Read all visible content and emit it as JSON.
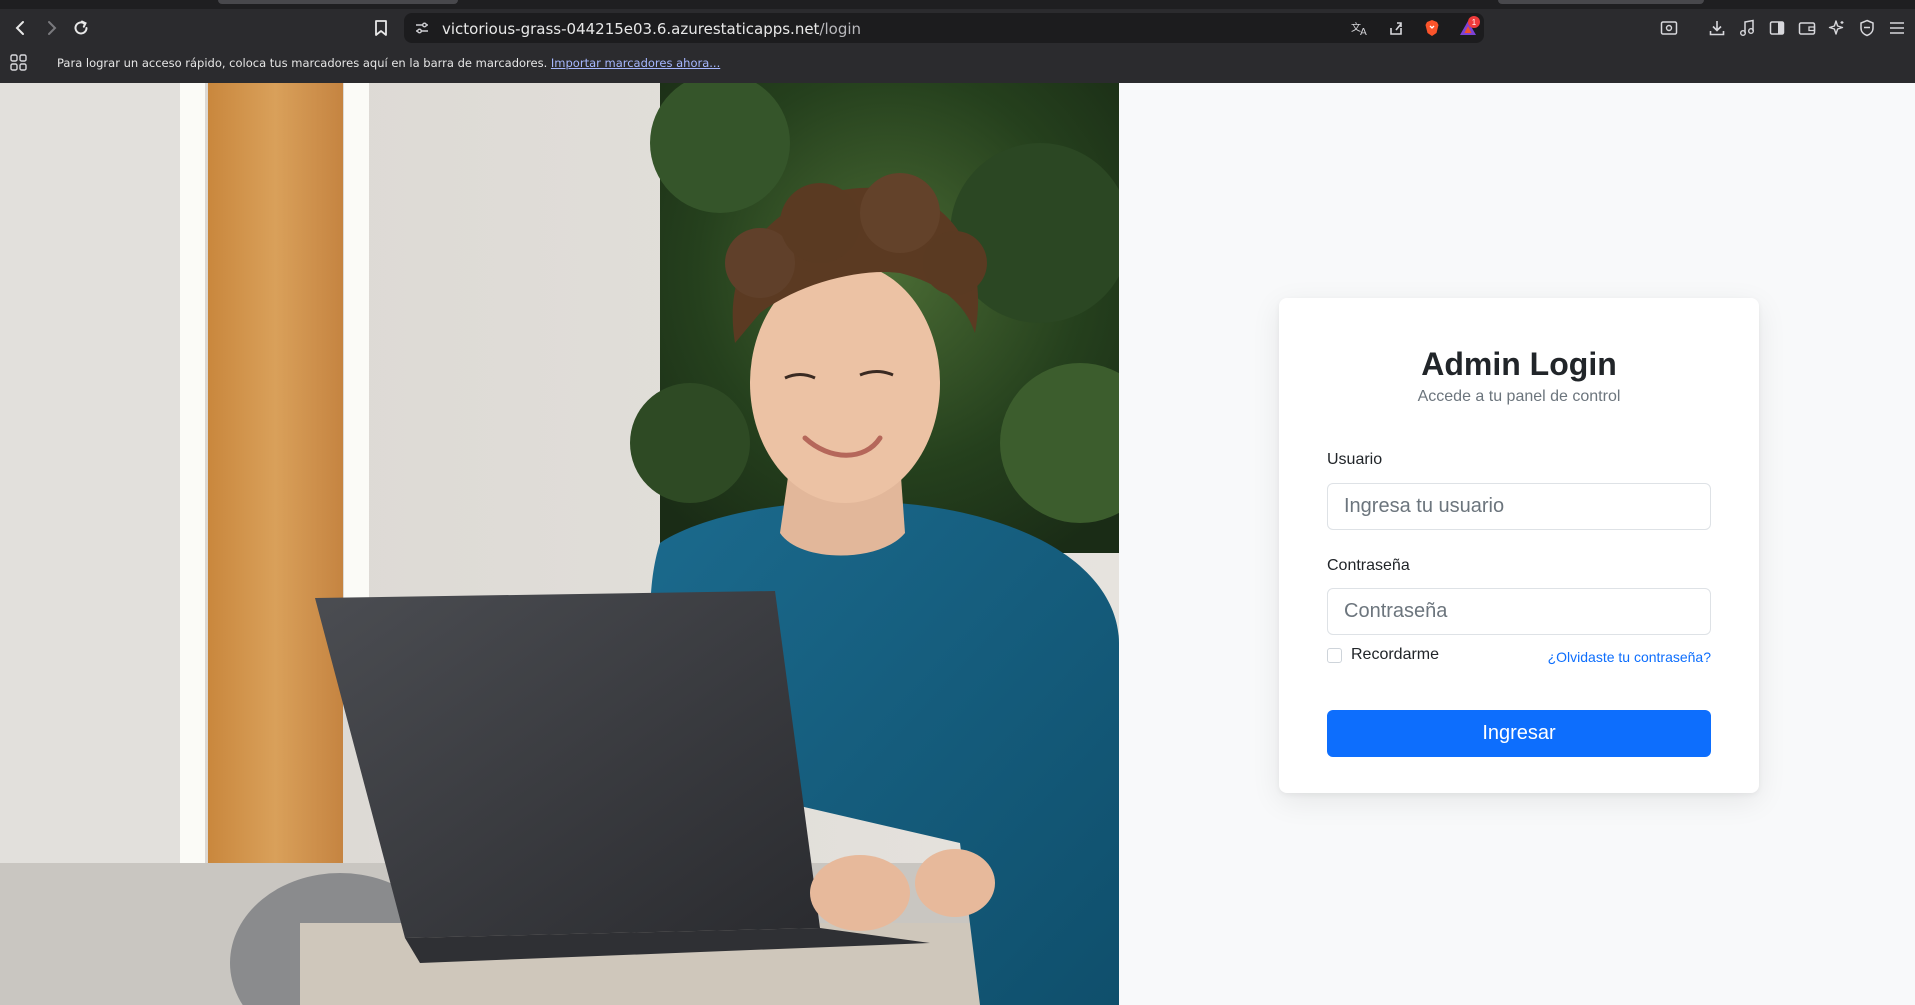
{
  "browser": {
    "url_host": "victorious-grass-044215e03.6.azurestaticapps.net",
    "url_path": "/login",
    "notification_count": "1",
    "bookmarks_bar": {
      "message": "Para lograr un acceso rápido, coloca tus marcadores aquí en la barra de marcadores.",
      "import_link": "Importar marcadores ahora..."
    }
  },
  "hero_image": {
    "alt": "Joven sonriente usando una laptop"
  },
  "login": {
    "title": "Admin Login",
    "subtitle": "Accede a tu panel de control",
    "username_label": "Usuario",
    "username_placeholder": "Ingresa tu usuario",
    "username_value": "",
    "password_label": "Contraseña",
    "password_placeholder": "Contraseña",
    "password_value": "",
    "remember_label": "Recordarme",
    "remember_checked": false,
    "forgot_link": "¿Olvidaste tu contraseña?",
    "submit_label": "Ingresar"
  },
  "colors": {
    "primary": "#0d6efd",
    "chrome_bg": "#2b2b2e",
    "page_bg": "#f8f9fa"
  }
}
